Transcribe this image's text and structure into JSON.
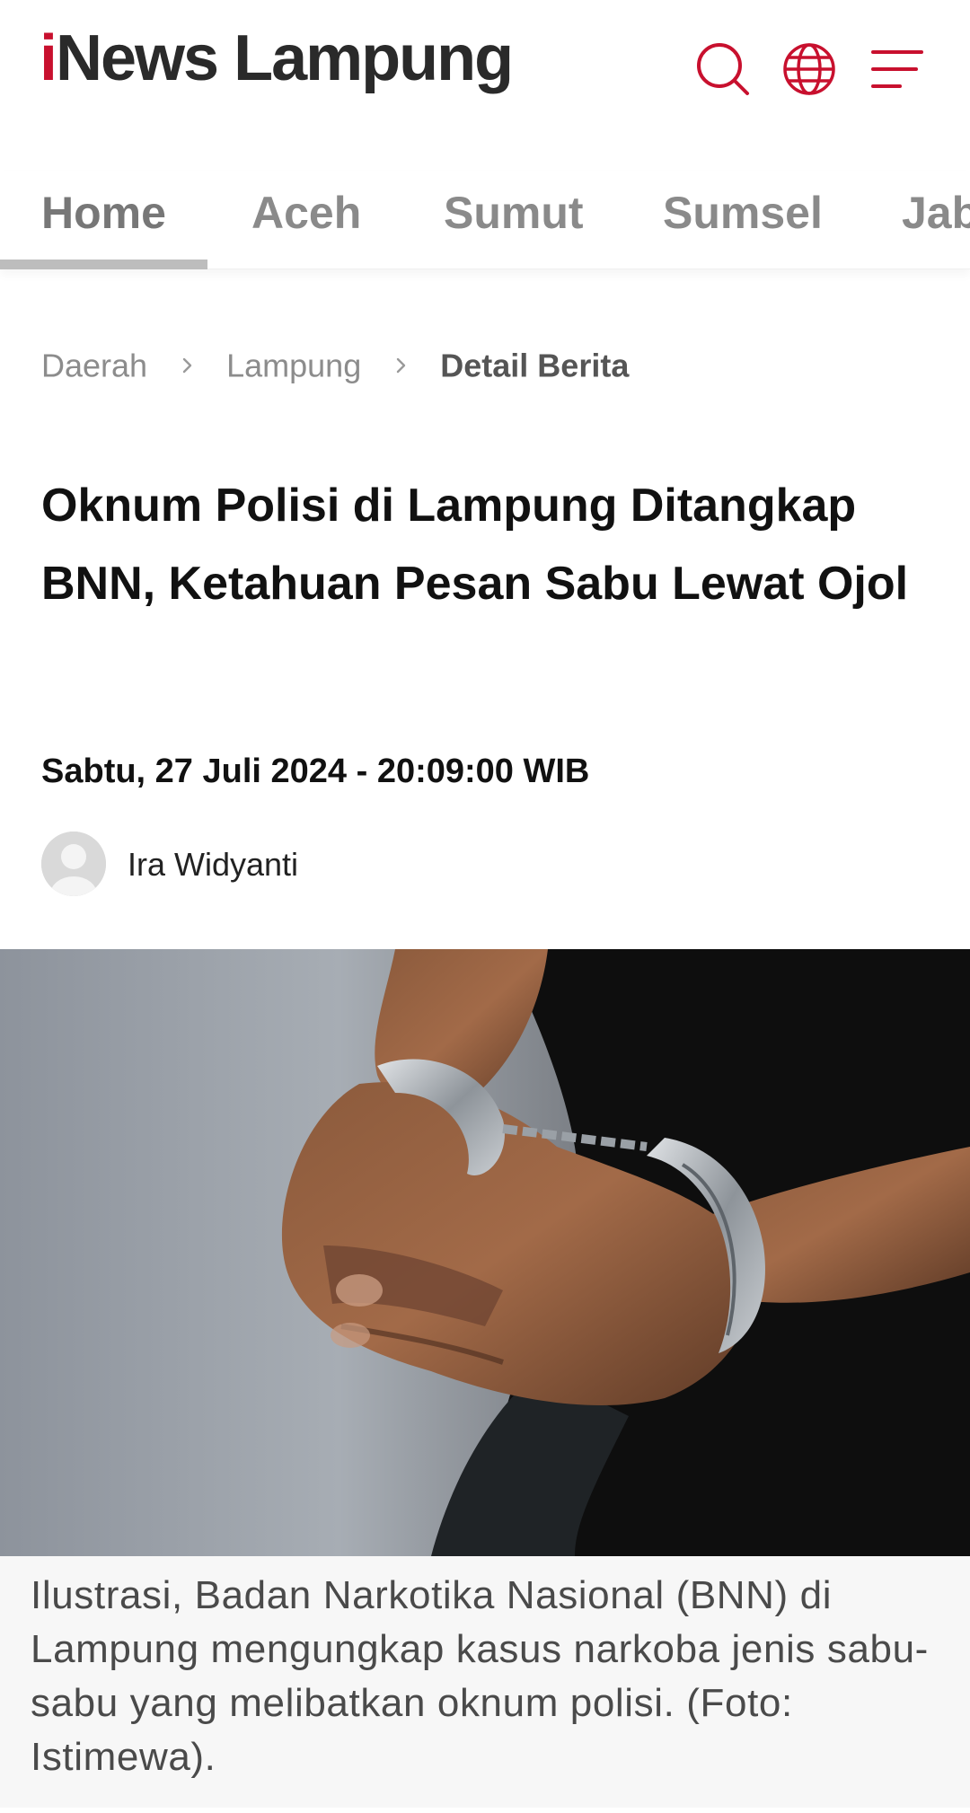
{
  "header": {
    "logo_prefix": "i",
    "logo_rest": "News Lampung",
    "icons": [
      "search-icon",
      "globe-icon",
      "menu-icon"
    ],
    "brand_color": "#c8102e"
  },
  "tabs": [
    {
      "label": "Home",
      "active": true
    },
    {
      "label": "Aceh"
    },
    {
      "label": "Sumut"
    },
    {
      "label": "Sumsel"
    },
    {
      "label": "Jab"
    }
  ],
  "breadcrumb": {
    "items": [
      "Daerah",
      "Lampung"
    ],
    "current": "Detail Berita"
  },
  "article": {
    "title": "Oknum Polisi di Lampung Ditangkap BNN, Ketahuan Pesan Sabu Lewat Ojol",
    "date": "Sabtu, 27 Juli 2024 - 20:09:00 WIB",
    "author": "Ira Widyanti",
    "image_caption": "Ilustrasi, Badan Narkotika Nasional (BNN) di Lampung mengungkap kasus narkoba jenis sabu-sabu yang melibatkan oknum polisi. (Foto: Istimewa)."
  }
}
